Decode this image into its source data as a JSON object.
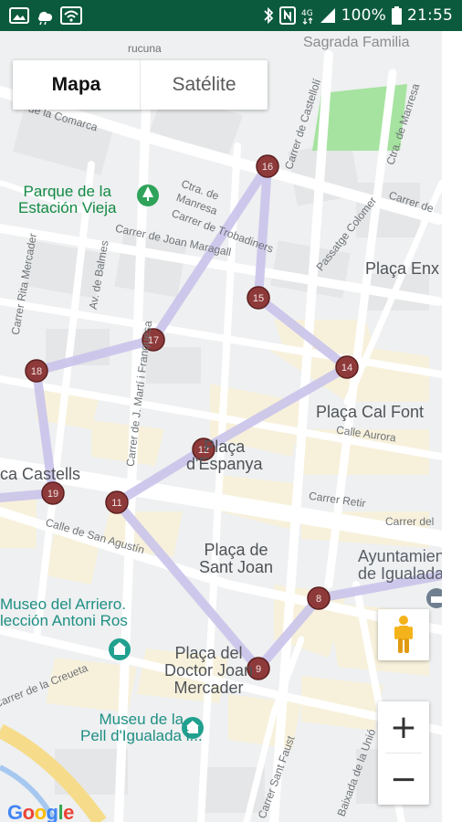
{
  "status_bar": {
    "battery_percent": "100%",
    "time": "21:55",
    "network": "4G",
    "left_icons": [
      "image-icon",
      "weather-icon",
      "wifi-icon"
    ],
    "right_icons": [
      "bluetooth-icon",
      "nfc-icon",
      "signal-icon",
      "battery-icon"
    ]
  },
  "map_type": {
    "options": [
      {
        "label": "Mapa",
        "active": true
      },
      {
        "label": "Satélite",
        "active": false
      }
    ]
  },
  "map": {
    "places": {
      "plaza_espanya": "Plaça\nd'Espanya",
      "plaza_sant_joan": "Plaça de\nSant Joan",
      "plaza_doctor": "Plaça del\nDoctor Joan\nMercader",
      "plaza_cal_font": "Plaça Cal Font",
      "plaza_enx": "Plaça Enx",
      "ayuntamiento": "Ayuntamiento\nde Igualada",
      "castells": "ca Castells",
      "sagrada": "Sagrada Familia"
    },
    "pois": {
      "parque": "Parque de la\nEstación Vieja",
      "museo_arriero": "Museo del Arriero.\nlección Antoni Ros",
      "museu_pell": "Museu de la\nPell d'Igualada i..."
    },
    "streets": {
      "comarca": "de la Comarca",
      "manresa": "Ctra. de\nManresa",
      "trobadiners": "Carrer de Trobadiners",
      "joan_maragall": "Carrer de Joan Maragall",
      "balmes": "Av. de Balmes",
      "mercader": "Carrer Rita Mercader",
      "castelloli": "Carrer de Castellolí",
      "manresa2": "Ctra. de Manresa",
      "colomer": "Passatge Colomer",
      "carrer_de": "Carrer de",
      "marti": "Carrer de J. Martí i Franquesa",
      "aurora": "Calle Aurora",
      "retir": "Carrer Retir",
      "carrer_del": "Carrer del",
      "san_agustin": "Calle de San Agustín",
      "creueta": "Carrer de la Creueta",
      "sant_faust": "Carrer Sant Faust",
      "baixada": "Baixada de la Unió",
      "rucuna": "rucuna"
    },
    "markers": [
      "8",
      "9",
      "11",
      "12",
      "14",
      "15",
      "16",
      "17",
      "18",
      "19"
    ]
  },
  "controls": {
    "zoom_in": "+",
    "zoom_out": "−"
  },
  "logo": {
    "letters": [
      "G",
      "o",
      "o",
      "g",
      "l",
      "e"
    ]
  },
  "colors": {
    "status_bar": "#0b5a3e",
    "route": "#c9c3ea",
    "marker": "#8e3a3a",
    "park": "#a6e3a0",
    "poi": "#1f8f84"
  }
}
